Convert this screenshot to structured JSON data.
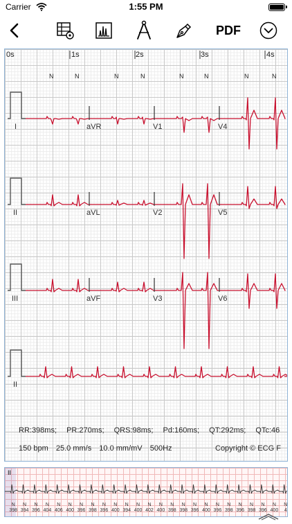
{
  "status_bar": {
    "carrier": "Carrier",
    "time": "1:55 PM"
  },
  "toolbar": {
    "icons": [
      "back-chevron-icon",
      "grid-settings-icon",
      "chart-bars-icon",
      "compass-icon",
      "pen-nib-icon",
      "pdf-text",
      "chevron-down-circle-icon"
    ],
    "pdf_label": "PDF"
  },
  "ecg": {
    "time_ticks": [
      "0s",
      "1s",
      "2s",
      "3s",
      "4s"
    ],
    "beat_marks": [
      "N",
      "N",
      "N",
      "N",
      "N",
      "N",
      "N",
      "N",
      "N",
      "N",
      "N"
    ],
    "leads": {
      "row1": [
        "I",
        "aVR",
        "V1",
        "V4"
      ],
      "row2": [
        "II",
        "aVL",
        "V2",
        "V5"
      ],
      "row3": [
        "III",
        "aVF",
        "V3",
        "V6"
      ],
      "row4": [
        "II"
      ]
    },
    "trace_color": "#c8102e",
    "stats": [
      "RR:398ms;",
      "PR:270ms;",
      "QRS:98ms;",
      "Pd:160ms;",
      "QT:292ms;",
      "QTc:46"
    ],
    "heart_rate": "150 bpm",
    "paper_speed": "25.0 mm/s",
    "gain": "10.0 mm/mV",
    "sample_rate": "500Hz",
    "copyright": "Copyright © ECG F"
  },
  "rhythm": {
    "lead": "II",
    "beats": [
      {
        "n": "N",
        "rr": "398"
      },
      {
        "n": "N",
        "rr": "394"
      },
      {
        "n": "N",
        "rr": "396"
      },
      {
        "n": "N",
        "rr": "404"
      },
      {
        "n": "N",
        "rr": "406"
      },
      {
        "n": "N",
        "rr": "400"
      },
      {
        "n": "N",
        "rr": "396"
      },
      {
        "n": "N",
        "rr": "398"
      },
      {
        "n": "N",
        "rr": "396"
      },
      {
        "n": "N",
        "rr": "400"
      },
      {
        "n": "N",
        "rr": "394"
      },
      {
        "n": "N",
        "rr": "400"
      },
      {
        "n": "N",
        "rr": "402"
      },
      {
        "n": "N",
        "rr": "400"
      },
      {
        "n": "N",
        "rr": "398"
      },
      {
        "n": "N",
        "rr": "398"
      },
      {
        "n": "N",
        "rr": "396"
      },
      {
        "n": "N",
        "rr": "400"
      },
      {
        "n": "N",
        "rr": "396"
      },
      {
        "n": "N",
        "rr": "398"
      },
      {
        "n": "N",
        "rr": "396"
      },
      {
        "n": "N",
        "rr": "398"
      },
      {
        "n": "N",
        "rr": "396"
      },
      {
        "n": "N",
        "rr": "400"
      },
      {
        "n": "N",
        "rr": "4"
      }
    ]
  }
}
